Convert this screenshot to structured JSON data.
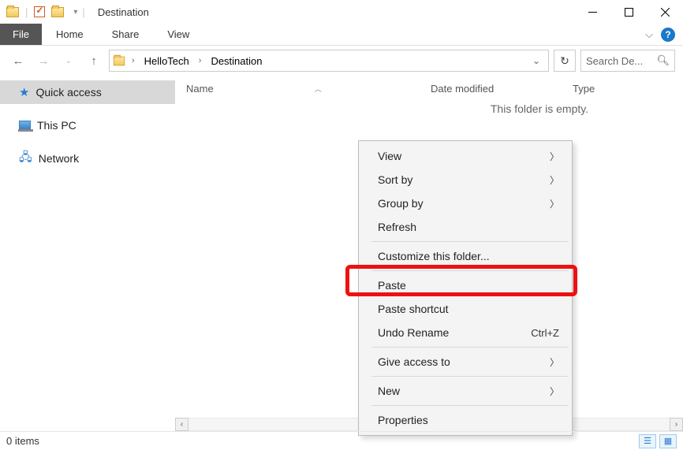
{
  "titlebar": {
    "title": "Destination"
  },
  "ribbon": {
    "file": "File",
    "tabs": [
      "Home",
      "Share",
      "View"
    ]
  },
  "nav": {
    "breadcrumbs": [
      "HelloTech",
      "Destination"
    ],
    "refresh_dropdown": "⌄",
    "search_placeholder": "Search De..."
  },
  "sidebar": {
    "items": [
      {
        "label": "Quick access"
      },
      {
        "label": "This PC"
      },
      {
        "label": "Network"
      }
    ]
  },
  "columns": {
    "name": "Name",
    "date": "Date modified",
    "type": "Type"
  },
  "content": {
    "empty": "This folder is empty."
  },
  "context_menu": {
    "view": "View",
    "sort_by": "Sort by",
    "group_by": "Group by",
    "refresh": "Refresh",
    "customize": "Customize this folder...",
    "paste": "Paste",
    "paste_shortcut": "Paste shortcut",
    "undo_rename": "Undo Rename",
    "undo_shortcut": "Ctrl+Z",
    "give_access": "Give access to",
    "new": "New",
    "properties": "Properties"
  },
  "statusbar": {
    "count": "0 items"
  }
}
